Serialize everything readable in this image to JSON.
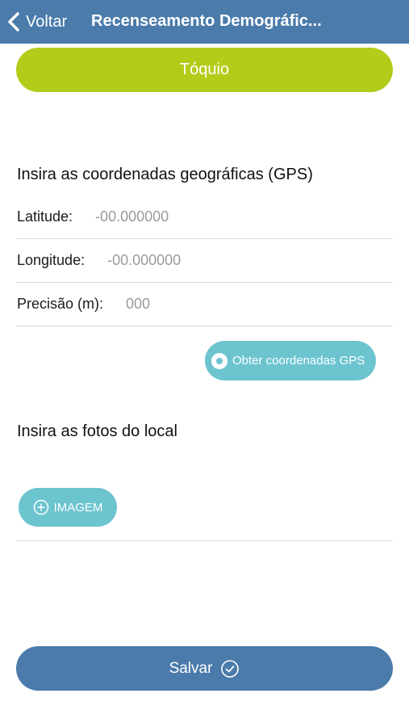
{
  "header": {
    "back_label": "Voltar",
    "title": "Recenseamento Demográfic..."
  },
  "city_button": {
    "label": "Tóquio"
  },
  "gps_section": {
    "title": "Insira as coordenadas geográficas (GPS)",
    "fields": [
      {
        "label": "Latitude:",
        "placeholder": "-00.000000"
      },
      {
        "label": "Longitude:",
        "placeholder": "-00.000000"
      },
      {
        "label": "Precisão (m):",
        "placeholder": "000"
      }
    ],
    "get_gps_button": "Obter coordenadas GPS"
  },
  "photos_section": {
    "title": "Insira as fotos do local",
    "image_button": "IMAGEM"
  },
  "save_button": {
    "label": "Salvar"
  },
  "colors": {
    "header": "#4a7bab",
    "city_button": "#b3cc1a",
    "accent_teal": "#6cc4cf",
    "save_button": "#4a7bab"
  },
  "icons": [
    "chevron-left-icon",
    "gps-target-icon",
    "add-circle-icon",
    "check-circle-icon"
  ]
}
